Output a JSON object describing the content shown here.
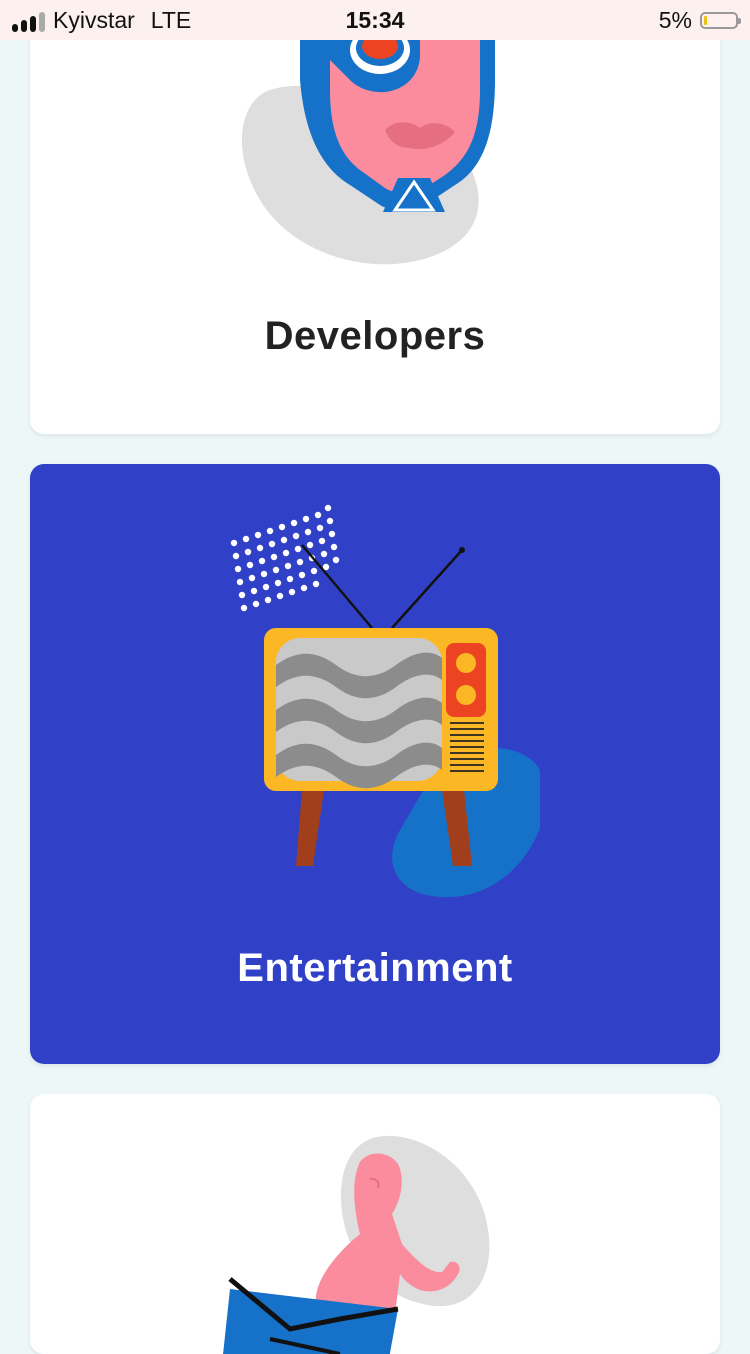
{
  "status_bar": {
    "carrier": "Kyivstar",
    "network": "LTE",
    "time": "15:34",
    "battery_percent": "5%"
  },
  "cards": [
    {
      "title": "Developers",
      "theme": "light",
      "illustration": "robot-face-illustration"
    },
    {
      "title": "Entertainment",
      "theme": "blue",
      "illustration": "retro-tv-illustration"
    },
    {
      "title": "",
      "theme": "light",
      "illustration": "man-with-laptop-illustration"
    }
  ],
  "colors": {
    "page_background": "#eef7f8",
    "card_light": "#ffffff",
    "card_blue": "#3141c7",
    "status_bar_background": "#fdf1ef"
  }
}
